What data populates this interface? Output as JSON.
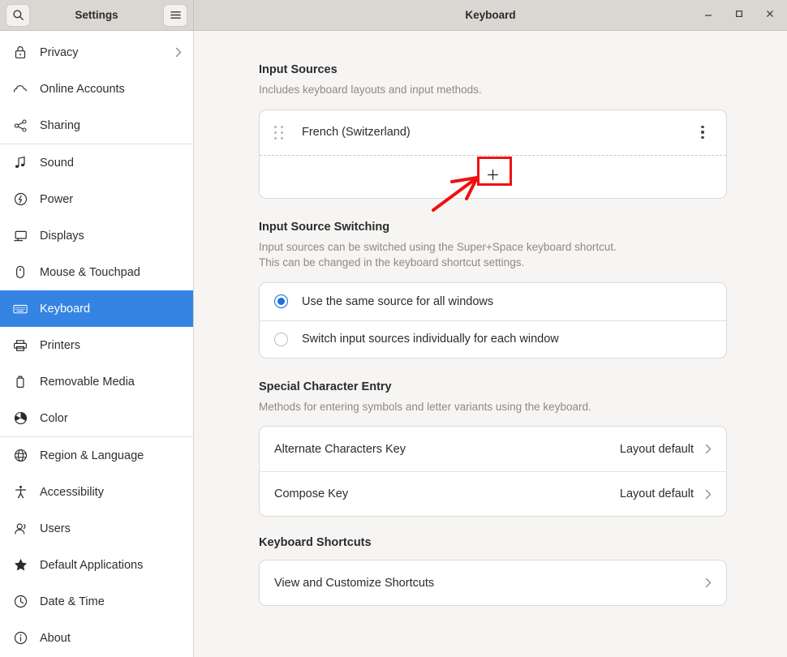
{
  "window": {
    "sidebar_title": "Settings",
    "main_title": "Keyboard",
    "search_icon": "search-icon",
    "menu_icon": "hamburger-menu-icon",
    "minimize_label": "–",
    "maximize_label": "□",
    "close_label": "✕"
  },
  "sidebar": {
    "groups": [
      {
        "items": [
          {
            "label": "Privacy",
            "icon": "lock-icon",
            "chevron": true,
            "selected": false
          },
          {
            "label": "Online Accounts",
            "icon": "cloud-icon",
            "chevron": false,
            "selected": false
          },
          {
            "label": "Sharing",
            "icon": "share-nodes-icon",
            "chevron": false,
            "selected": false
          }
        ]
      },
      {
        "items": [
          {
            "label": "Sound",
            "icon": "music-note-icon",
            "chevron": false,
            "selected": false
          },
          {
            "label": "Power",
            "icon": "power-bolt-icon",
            "chevron": false,
            "selected": false
          },
          {
            "label": "Displays",
            "icon": "monitor-icon",
            "chevron": false,
            "selected": false
          },
          {
            "label": "Mouse & Touchpad",
            "icon": "mouse-icon",
            "chevron": false,
            "selected": false
          },
          {
            "label": "Keyboard",
            "icon": "keyboard-icon",
            "chevron": false,
            "selected": true
          },
          {
            "label": "Printers",
            "icon": "printer-icon",
            "chevron": false,
            "selected": false
          },
          {
            "label": "Removable Media",
            "icon": "usb-drive-icon",
            "chevron": false,
            "selected": false
          },
          {
            "label": "Color",
            "icon": "color-wheel-icon",
            "chevron": false,
            "selected": false
          }
        ]
      },
      {
        "items": [
          {
            "label": "Region & Language",
            "icon": "globe-icon",
            "chevron": false,
            "selected": false
          },
          {
            "label": "Accessibility",
            "icon": "accessibility-person-icon",
            "chevron": false,
            "selected": false
          },
          {
            "label": "Users",
            "icon": "users-icon",
            "chevron": false,
            "selected": false
          },
          {
            "label": "Default Applications",
            "icon": "star-icon",
            "chevron": false,
            "selected": false
          },
          {
            "label": "Date & Time",
            "icon": "clock-icon",
            "chevron": false,
            "selected": false
          },
          {
            "label": "About",
            "icon": "info-circle-icon",
            "chevron": false,
            "selected": false
          }
        ]
      }
    ]
  },
  "main": {
    "input_sources": {
      "title": "Input Sources",
      "description": "Includes keyboard layouts and input methods.",
      "sources": [
        {
          "label": "French (Switzerland)",
          "menu_icon": "kebab-menu-icon",
          "drag_icon": "drag-handle-icon"
        }
      ],
      "add_button_label": "+",
      "add_button_icon": "plus-icon"
    },
    "input_source_switching": {
      "title": "Input Source Switching",
      "description_line1": "Input sources can be switched using the Super+Space keyboard shortcut.",
      "description_line2": "This can be changed in the keyboard shortcut settings.",
      "options": [
        {
          "label": "Use the same source for all windows",
          "selected": true
        },
        {
          "label": "Switch input sources individually for each window",
          "selected": false
        }
      ]
    },
    "special_character_entry": {
      "title": "Special Character Entry",
      "description": "Methods for entering symbols and letter variants using the keyboard.",
      "rows": [
        {
          "label": "Alternate Characters Key",
          "value": "Layout default"
        },
        {
          "label": "Compose Key",
          "value": "Layout default"
        }
      ]
    },
    "keyboard_shortcuts": {
      "title": "Keyboard Shortcuts",
      "rows": [
        {
          "label": "View and Customize Shortcuts",
          "value": ""
        }
      ]
    }
  },
  "annotation": {
    "highlight_color": "#ee1111",
    "arrow_color": "#ee1111",
    "target": "add-input-source-button"
  }
}
